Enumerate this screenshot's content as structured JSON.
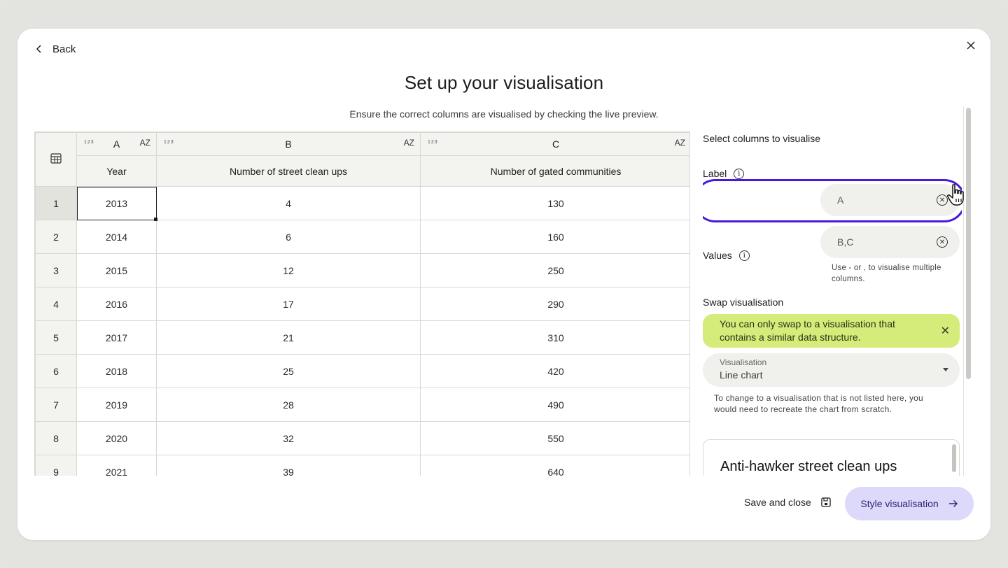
{
  "header": {
    "back_label": "Back",
    "title": "Set up your visualisation",
    "subtitle": "Ensure the correct columns are visualised by checking the live preview."
  },
  "table": {
    "type_icon_text": "123",
    "sort_icon_text": "AZ",
    "columns": [
      {
        "letter": "A",
        "name": "Year"
      },
      {
        "letter": "B",
        "name": "Number of street clean ups"
      },
      {
        "letter": "C",
        "name": "Number of gated communities"
      }
    ],
    "rows": [
      {
        "n": "1",
        "a": "2013",
        "b": "4",
        "c": "130"
      },
      {
        "n": "2",
        "a": "2014",
        "b": "6",
        "c": "160"
      },
      {
        "n": "3",
        "a": "2015",
        "b": "12",
        "c": "250"
      },
      {
        "n": "4",
        "a": "2016",
        "b": "17",
        "c": "290"
      },
      {
        "n": "5",
        "a": "2017",
        "b": "21",
        "c": "310"
      },
      {
        "n": "6",
        "a": "2018",
        "b": "25",
        "c": "420"
      },
      {
        "n": "7",
        "a": "2019",
        "b": "28",
        "c": "490"
      },
      {
        "n": "8",
        "a": "2020",
        "b": "32",
        "c": "550"
      },
      {
        "n": "9",
        "a": "2021",
        "b": "39",
        "c": "640"
      }
    ]
  },
  "panel": {
    "select_heading": "Select columns to visualise",
    "label_field": {
      "label": "Label",
      "value": "A"
    },
    "values_field": {
      "label": "Values",
      "value": "B,C",
      "hint": "Use - or , to visualise multiple columns."
    },
    "swap_heading": "Swap visualisation",
    "notice": "You can only swap to a visualisation that contains a similar data structure.",
    "visualisation": {
      "label": "Visualisation",
      "value": "Line chart"
    },
    "visualisation_hint": "To change to a visualisation that is not listed here, you would need to recreate the chart from scratch.",
    "preview_title": "Anti-hawker street clean ups have been happening more frequently across the years"
  },
  "footer": {
    "save_close_label": "Save and close",
    "style_label": "Style visualisation"
  },
  "colors": {
    "accent": "#4a18d8",
    "notice_bg": "#d5ec7a",
    "primary_button_bg": "#dcd9fb"
  }
}
